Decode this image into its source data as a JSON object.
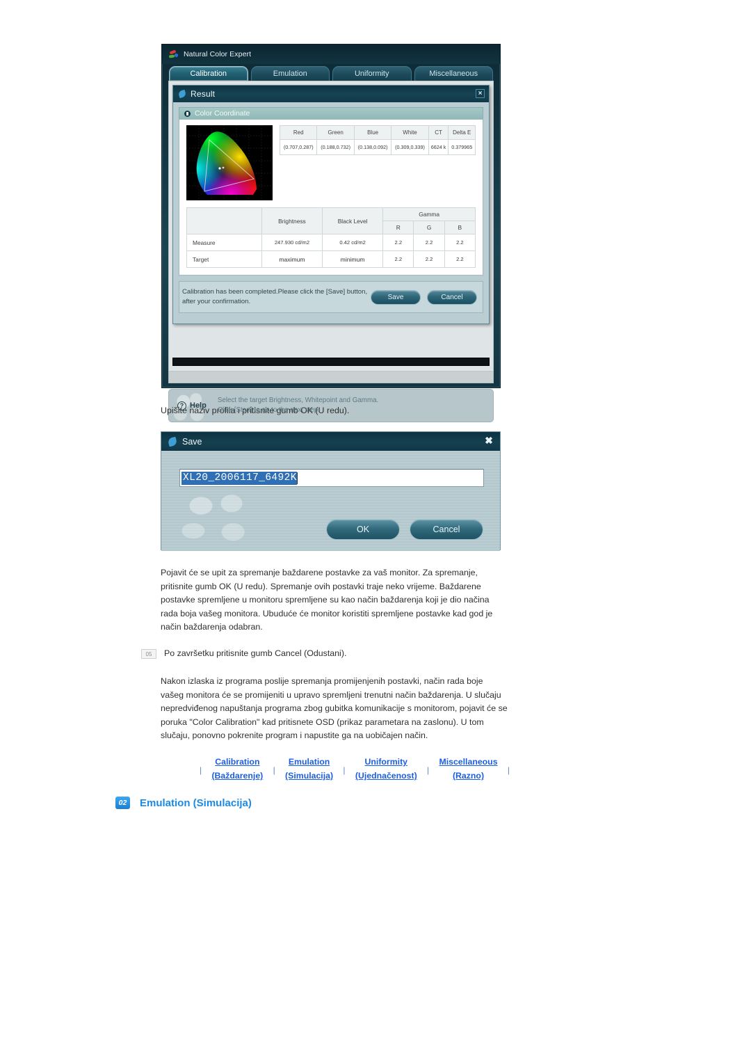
{
  "app": {
    "title": "Natural Color Expert",
    "tabs": [
      {
        "label": "Calibration",
        "active": true
      },
      {
        "label": "Emulation",
        "active": false
      },
      {
        "label": "Uniformity",
        "active": false
      },
      {
        "label": "Miscellaneous",
        "active": false
      }
    ],
    "dialog": {
      "title": "Result",
      "close_label": "×",
      "section_title": "Color Coordinate",
      "coord_table": {
        "headers": [
          "Red",
          "Green",
          "Blue",
          "White",
          "CT",
          "Delta E"
        ],
        "values": [
          "(0.707,0.287)",
          "(0.188,0.732)",
          "(0.138,0.092)",
          "(0.309,0.339)",
          "6624 k",
          "0.379965"
        ]
      },
      "measure_table": {
        "col_blank": "",
        "col_brightness": "Brightness",
        "col_black_level": "Black Level",
        "col_gamma": "Gamma",
        "gamma_sub": [
          "R",
          "G",
          "B"
        ],
        "rows": [
          {
            "label": "Measure",
            "brightness": "247.930 cd/m2",
            "black_level": "0.42 cd/m2",
            "gamma_r": "2.2",
            "gamma_g": "2.2",
            "gamma_b": "2.2"
          },
          {
            "label": "Target",
            "brightness": "maximum",
            "black_level": "minimum",
            "gamma_r": "2.2",
            "gamma_g": "2.2",
            "gamma_b": "2.2"
          }
        ]
      },
      "message": "Calibration has been completed.Please click the [Save] button, after your confirmation.",
      "save_button": "Save",
      "cancel_button": "Cancel"
    },
    "help": {
      "label": "Help",
      "icon_glyph": "?",
      "line1": "Select the target Brightness, Whitepoint and Gamma.",
      "line2": "Click [Start] to go to the next step."
    }
  },
  "save_dialog": {
    "title": "Save",
    "close_label": "✖",
    "input_value": "XL20_2006117_6492K",
    "ok_button": "OK",
    "cancel_button": "Cancel"
  },
  "document": {
    "paragraph_1": "Upišite naziv profila i pritisnite gumb OK (U redu).",
    "paragraph_2": "Pojavit će se upit za spremanje baždarene postavke za vaš monitor. Za spremanje, pritisnite gumb OK (U redu). Spremanje ovih postavki traje neko vrijeme. Baždarene postavke spremljene u monitoru spremljene su kao način baždarenja koji je dio načina rada boja vašeg monitora. Ubuduće će monitor koristiti spremljene postavke kad god je način baždarenja odabran.",
    "step": {
      "number": "05",
      "text": "Po završetku pritisnite gumb Cancel (Odustani)."
    },
    "paragraph_3": "Nakon izlaska iz programa poslije spremanja promijenjenih postavki, način rada boje vašeg monitora će se promijeniti u upravo spremljeni trenutni način baždarenja. U slučaju nepredviđenog napuštanja programa zbog gubitka komunikacije s monitorom, pojavit će se poruka \"Color Calibration\" kad pritisnete OSD (prikaz parametara na zaslonu). U tom slučaju, ponovno pokrenite program i napustite ga na uobičajen način."
  },
  "nav_links": {
    "separator": "|",
    "items": [
      {
        "en": "Calibration",
        "hr": "(Baždarenje)"
      },
      {
        "en": "Emulation",
        "hr": "(Simulacija)"
      },
      {
        "en": "Uniformity",
        "hr": "(Ujednačenost)"
      },
      {
        "en": "Miscellaneous",
        "hr": "(Razno)"
      }
    ]
  },
  "section_heading": {
    "number": "02",
    "title": "Emulation (Simulacija)"
  },
  "colors": {
    "link_blue": "#1b5fe0",
    "heading_blue": "#1b8ae5",
    "badge_blue": "#1c7fd4",
    "window_teal": "#16404f",
    "dialog_bg": "#b9cdd2"
  }
}
